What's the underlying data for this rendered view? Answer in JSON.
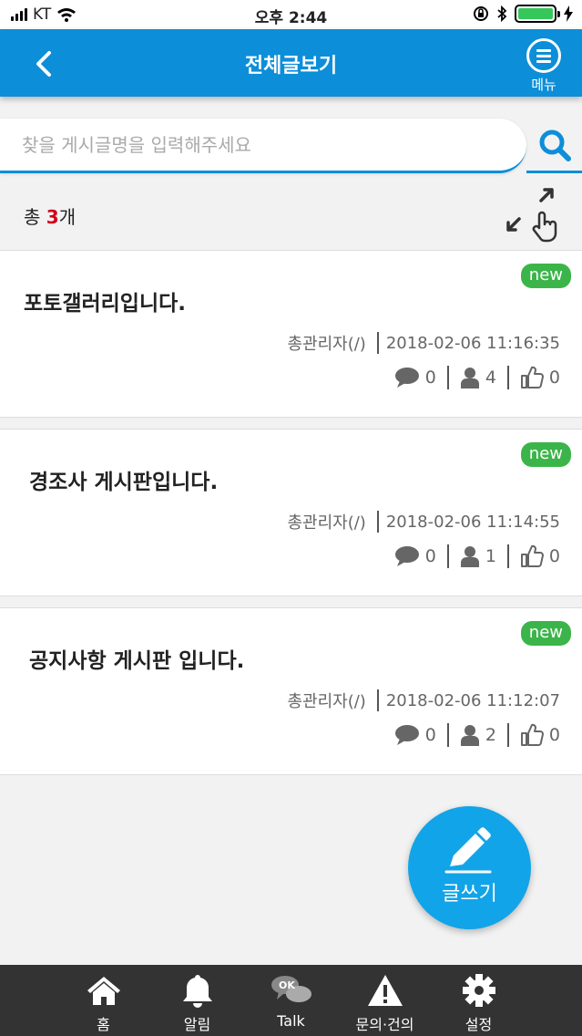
{
  "status_bar": {
    "carrier": "KT",
    "time": "오후 2:44"
  },
  "header": {
    "title": "전체글보기",
    "menu_label": "메뉴"
  },
  "search": {
    "placeholder": "찾을 게시글명을 입력해주세요"
  },
  "count": {
    "prefix": "총 ",
    "number": "3",
    "suffix": "개"
  },
  "posts": [
    {
      "badge": "new",
      "title": "포토갤러리입니다.",
      "author": "총관리자(/)",
      "datetime": "2018-02-06 11:16:35",
      "comments": "0",
      "views": "4",
      "likes": "0"
    },
    {
      "badge": "new",
      "title": "경조사 게시판입니다.",
      "author": "총관리자(/)",
      "datetime": "2018-02-06 11:14:55",
      "comments": "0",
      "views": "1",
      "likes": "0"
    },
    {
      "badge": "new",
      "title": "공지사항 게시판 입니다.",
      "author": "총관리자(/)",
      "datetime": "2018-02-06 11:12:07",
      "comments": "0",
      "views": "2",
      "likes": "0"
    }
  ],
  "fab": {
    "label": "글쓰기"
  },
  "bottom_nav": [
    {
      "label": "홈",
      "icon": "home-icon"
    },
    {
      "label": "알림",
      "icon": "bell-icon"
    },
    {
      "label": "Talk",
      "icon": "talk-icon"
    },
    {
      "label": "문의·건의",
      "icon": "warning-icon"
    },
    {
      "label": "설정",
      "icon": "gear-icon"
    }
  ],
  "colors": {
    "primary": "#0c8ed9",
    "badge": "#3bb54a",
    "count_highlight": "#d0021b",
    "fab": "#12a4e8",
    "nav_bg": "#333333"
  }
}
